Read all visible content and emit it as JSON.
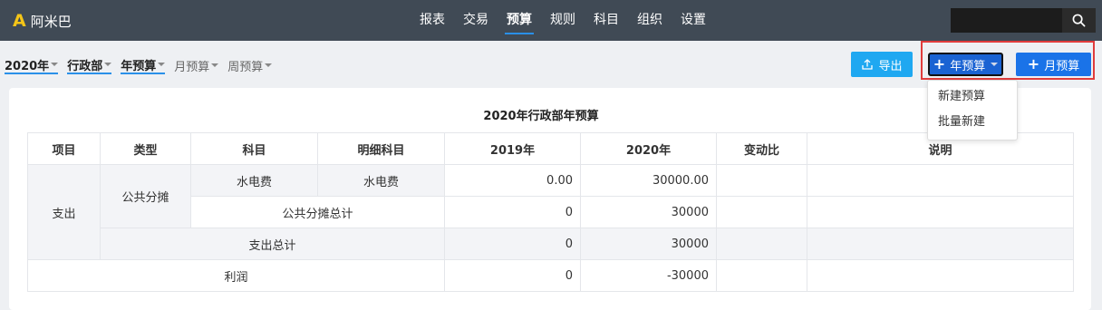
{
  "app": {
    "logo_letter": "A",
    "name": "阿米巴"
  },
  "nav": {
    "items": [
      "报表",
      "交易",
      "预算",
      "规则",
      "科目",
      "组织",
      "设置"
    ],
    "active": "预算"
  },
  "search": {
    "value": ""
  },
  "filters": {
    "year": "2020年",
    "dept": "行政部",
    "period_year": "年预算",
    "period_month": "月预算",
    "period_week": "周预算"
  },
  "toolbar": {
    "export_label": "导出",
    "year_budget_label": "年预算",
    "month_budget_label": "月预算"
  },
  "dropdown": {
    "options": [
      "新建预算",
      "批量新建"
    ]
  },
  "colors": {
    "topbar": "#404a55",
    "accent": "#1a73e8",
    "highlight": "#e03c3c"
  },
  "report": {
    "title": "2020年行政部年预算",
    "headers": [
      "项目",
      "类型",
      "科目",
      "明细科目",
      "2019年",
      "2020年",
      "变动比",
      "说明"
    ],
    "rows": {
      "expense_label": "支出",
      "shared_label": "公共分摊",
      "utility_item": "水电费",
      "utility_detail": "水电费",
      "utility_2019": "0.00",
      "utility_2020": "30000.00",
      "shared_total_label": "公共分摊总计",
      "shared_total_2019": "0",
      "shared_total_2020": "30000",
      "expense_total_label": "支出总计",
      "expense_total_2019": "0",
      "expense_total_2020": "30000",
      "profit_label": "利润",
      "profit_2019": "0",
      "profit_2020": "-30000"
    }
  }
}
